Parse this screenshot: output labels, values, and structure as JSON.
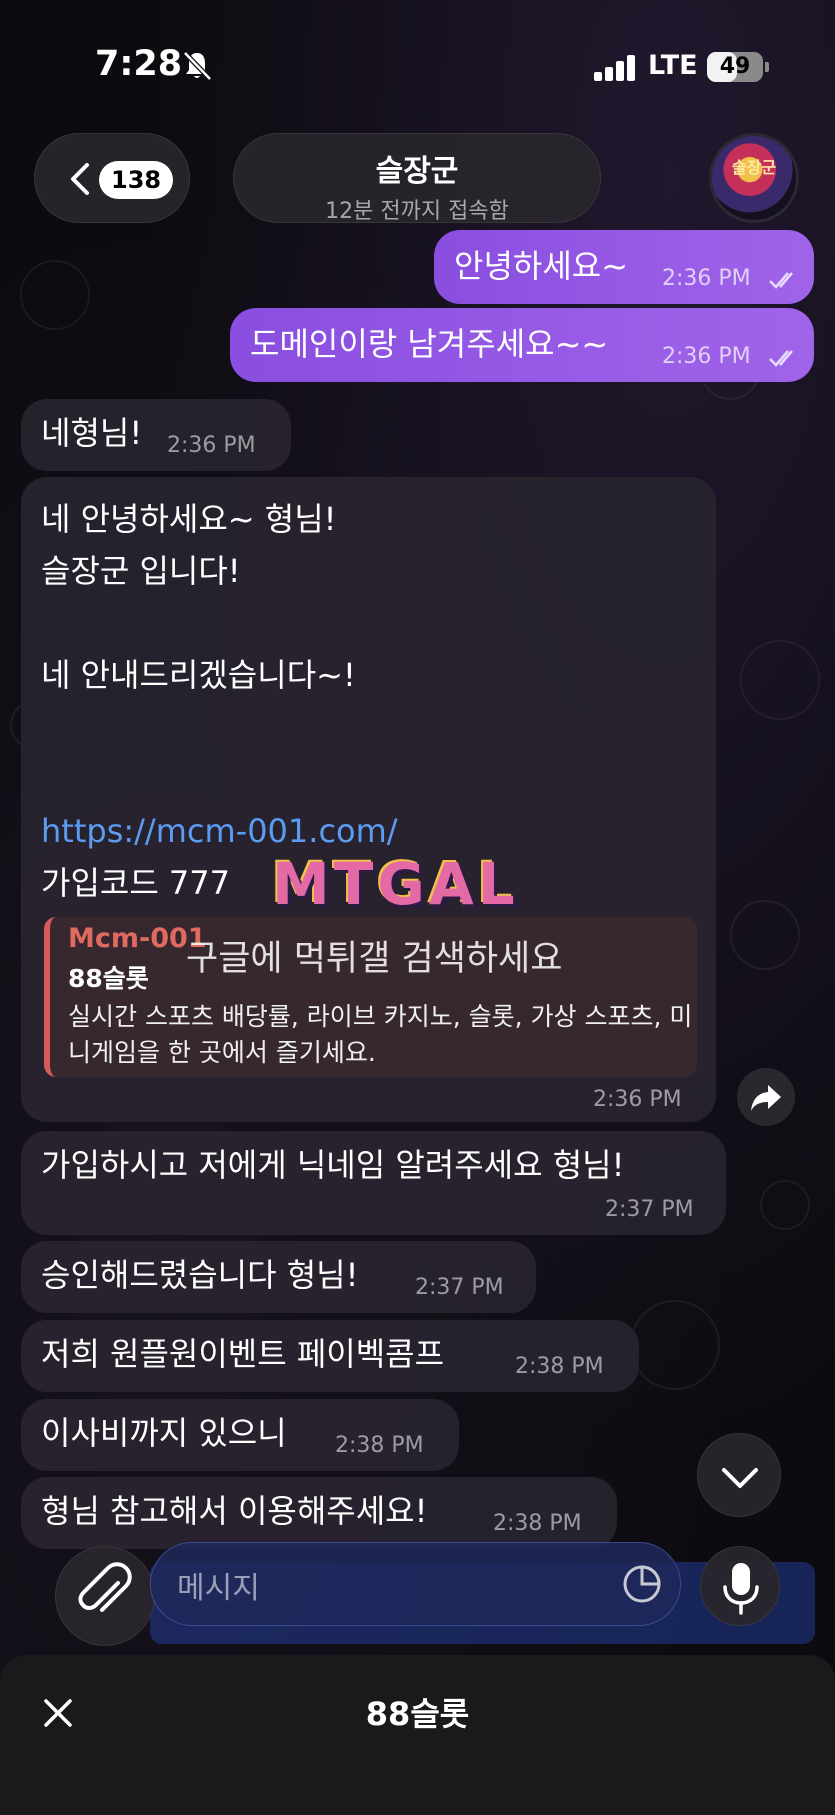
{
  "status_bar": {
    "time": "7:28",
    "network": "LTE",
    "battery": "49"
  },
  "header": {
    "back_count": "138",
    "title": "슬장군",
    "subtitle": "12분 전까지 접속함",
    "avatar_text": "슬장군"
  },
  "messages": [
    {
      "direction": "out",
      "text": "안녕하세요~",
      "time": "2:36 PM",
      "read": true
    },
    {
      "direction": "out",
      "text": "도메인이랑 남겨주세요~~",
      "time": "2:36 PM",
      "read": true
    },
    {
      "direction": "in",
      "text": "네형님!",
      "time": "2:36 PM"
    },
    {
      "direction": "in",
      "lines": [
        "네 안녕하세요~ 형님!",
        "슬장군 입니다!",
        "",
        "네 안내드리겠습니다~!"
      ],
      "link": "https://mcm-001.com/",
      "code_line": "가입코드 777",
      "preview": {
        "site": "Mcm-001",
        "title": "88슬롯",
        "description": "실시간 스포츠 배당률, 라이브 카지노, 슬롯, 가상 스포츠, 미니게임을 한 곳에서 즐기세요."
      },
      "time": "2:36 PM"
    },
    {
      "direction": "in",
      "text": "가입하시고 저에게 닉네임 알려주세요 형님!",
      "time": "2:37 PM"
    },
    {
      "direction": "in",
      "text": "승인해드렸습니다 형님!",
      "time": "2:37 PM"
    },
    {
      "direction": "in",
      "text": "저희 원플원이벤트 페이벡콤프",
      "time": "2:38 PM"
    },
    {
      "direction": "in",
      "text": "이사비까지 있으니",
      "time": "2:38 PM"
    },
    {
      "direction": "in",
      "text": "형님 참고해서 이용해주세요!",
      "time": "2:38 PM"
    }
  ],
  "watermark": {
    "logo": "MTGAL",
    "text": "구글에 먹튀갤 검색하세요"
  },
  "composer": {
    "placeholder": "메시지"
  },
  "bottom_sheet": {
    "title": "88슬롯"
  },
  "colors": {
    "outgoing_bubble": "#9a5ee8",
    "incoming_bubble": "#28242e",
    "link": "#5b9cf2",
    "preview_accent": "#d65b5b"
  }
}
